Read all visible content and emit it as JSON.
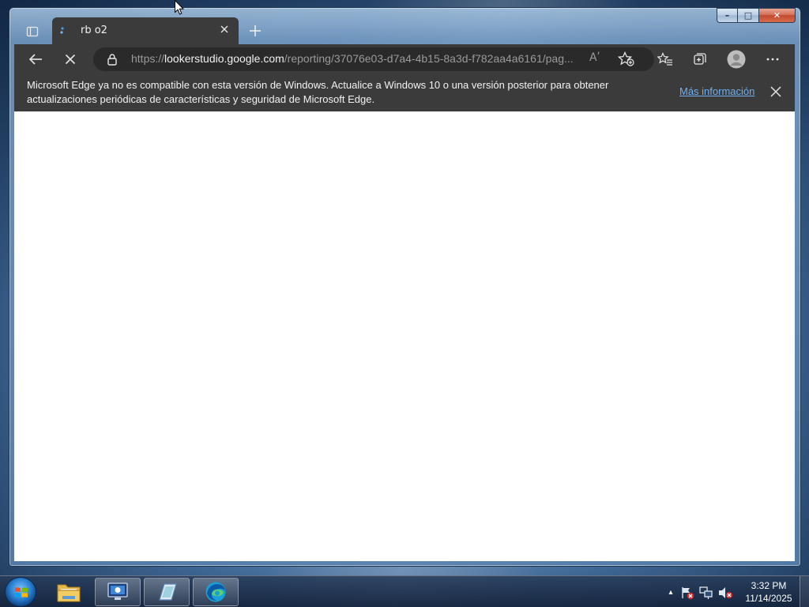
{
  "browser": {
    "tab": {
      "title": "rb o2",
      "favicon": "looker-studio-icon"
    },
    "address": {
      "scheme": "https://",
      "host": "lookerstudio.google.com",
      "path": "/reporting/37076e03-d7a4-4b15-8a3d-f782aa4a6161/pag..."
    },
    "read_aloud_glyph": "Aʹ",
    "infobar": {
      "message": "Microsoft Edge ya no es compatible con esta versión de Windows. Actualice a Windows 10 o una versión posterior para obtener actualizaciones periódicas de características y seguridad de Microsoft Edge.",
      "link": "Más información"
    }
  },
  "window_controls": {
    "minimize": "–",
    "maximize": "□",
    "close": "✕"
  },
  "taskbar": {
    "clock": {
      "time": "3:32 PM",
      "date": "11/14/2025"
    },
    "tray_expand": "▴"
  },
  "colors": {
    "browser_chrome": "#3b3b3b",
    "link": "#6fb0f2",
    "content_bg": "#ffffff"
  }
}
